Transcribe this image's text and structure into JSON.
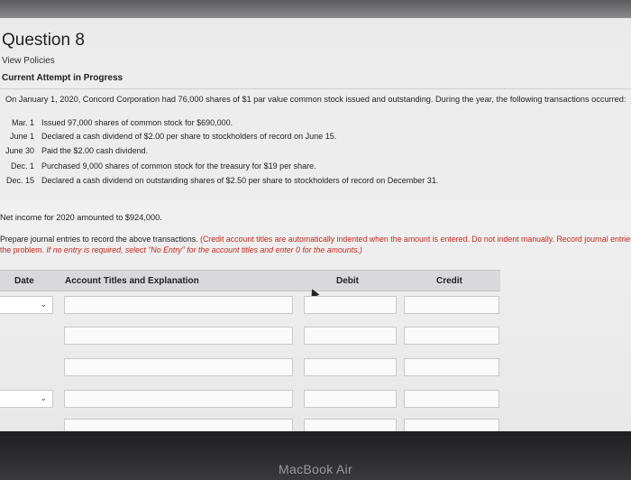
{
  "header": {
    "title": "Question 8",
    "view_policies": "View Policies",
    "attempt_status": "Current Attempt in Progress"
  },
  "problem": {
    "intro": "On January 1, 2020, Concord Corporation had 76,000 shares of $1 par value common stock issued and outstanding. During the year, the following transactions occurred:",
    "transactions": [
      {
        "date": "Mar. 1",
        "text": "Issued 97,000 shares of common stock for $690,000."
      },
      {
        "date": "June 1",
        "text": "Declared a cash dividend of $2.00 per share to stockholders of record on June 15."
      },
      {
        "date": "June 30",
        "text": "Paid the $2.00 cash dividend."
      },
      {
        "date": "Dec. 1",
        "text": "Purchased 9,000 shares of common stock for the treasury for $19 per share."
      },
      {
        "date": "Dec. 15",
        "text": "Declared a cash dividend on outstanding shares of $2.50 per share to stockholders of record on December 31."
      }
    ],
    "net_income": "Net income for 2020 amounted to $924,000."
  },
  "instructions": {
    "line1_plain": "Prepare journal entries to record the above transactions.",
    "line1_red": "(Credit account titles are automatically indented when the amount is entered. Do not indent manually. Record journal entries in the order presented in",
    "line2_red": "the problem.",
    "line2_italic": "If no entry is required, select \"No Entry\" for the account titles and enter 0 for the amounts.)"
  },
  "table": {
    "col_date": "Date",
    "col_account": "Account Titles and Explanation",
    "col_debit": "Debit",
    "col_credit": "Credit"
  },
  "device": {
    "brand": "MacBook Air"
  }
}
